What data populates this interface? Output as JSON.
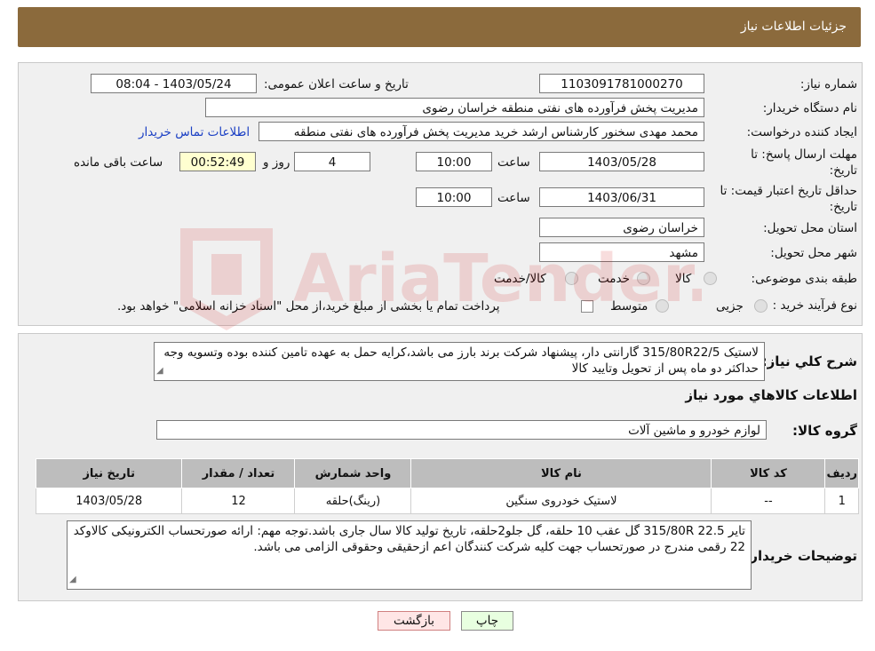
{
  "header": {
    "title": "جزئیات اطلاعات نیاز"
  },
  "form": {
    "need_number_label": "شماره نیاز:",
    "need_number": "1103091781000270",
    "announce_label": "تاریخ و ساعت اعلان عمومی:",
    "announce_value": "1403/05/24 - 08:04",
    "buyer_org_label": "نام دستگاه خریدار:",
    "buyer_org": "مدیریت پخش فرآورده های نفتی منطقه خراسان رضوی",
    "requester_label": "ایجاد کننده درخواست:",
    "requester": "محمد مهدی سخنور کارشناس ارشد خرید مدیریت پخش فرآورده های نفتی منطقه",
    "contact_link": "اطلاعات تماس خریدار",
    "deadline_label_1": "مهلت ارسال پاسخ: تا",
    "deadline_label_2": "تاریخ:",
    "deadline_date": "1403/05/28",
    "time_label": "ساعت",
    "deadline_time": "10:00",
    "days_value": "4",
    "days_label": "روز و",
    "remaining_time": "00:52:49",
    "remaining_label": "ساعت باقی مانده",
    "validity_label_1": "حداقل تاریخ اعتبار قیمت: تا",
    "validity_label_2": "تاریخ:",
    "validity_date": "1403/06/31",
    "validity_time_label": "ساعت",
    "validity_time": "10:00",
    "province_label": "استان محل تحویل:",
    "province": "خراسان رضوی",
    "city_label": "شهر محل تحویل:",
    "city": "مشهد",
    "category_label": "طبقه بندی موضوعی:",
    "category_options": [
      "کالا",
      "خدمت",
      "کالا/خدمت"
    ],
    "process_label": "نوع فرآیند خرید :",
    "process_options": [
      "جزیی",
      "متوسط"
    ],
    "payment_note": "پرداخت تمام یا بخشی از مبلغ خرید،از محل \"اسناد خزانه اسلامی\" خواهد بود."
  },
  "description": {
    "label": "شرح كلي نياز:",
    "text": "لاستیک 315/80R22/5 گارانتی دار، پیشنهاد شرکت برند بارز می باشد،کرایه حمل به عهده تامین کننده بوده وتسویه وجه حداکثر دو ماه پس از تحویل وتایید کالا"
  },
  "goods": {
    "section_title": "اطلاعات كالاهاي مورد نياز",
    "group_label": "گروه کالا:",
    "group_value": "لوازم خودرو و ماشین آلات",
    "table": {
      "headers": [
        "ردیف",
        "کد کالا",
        "نام کالا",
        "واحد شمارش",
        "تعداد / مقدار",
        "تاریخ نیاز"
      ],
      "rows": [
        [
          "1",
          "--",
          "لاستیک خودروی سنگین",
          "(رینگ)حلقه",
          "12",
          "1403/05/28"
        ]
      ]
    }
  },
  "buyer_notes": {
    "label": "توضیحات خریدار:",
    "text": "تایر 315/80R 22.5 گل عقب 10 حلقه، گل جلو2حلقه، تاریخ تولید کالا سال جاری باشد.توجه مهم: ارائه صورتحساب الکترونیکی کالاوکد 22 رقمی مندرج در صورتحساب جهت کلیه شرکت کنندگان اعم ازحقیقی وحقوقی الزامی می باشد."
  },
  "buttons": {
    "print": "چاپ",
    "back": "بازگشت"
  },
  "watermark_text": "AriaTender.neT"
}
